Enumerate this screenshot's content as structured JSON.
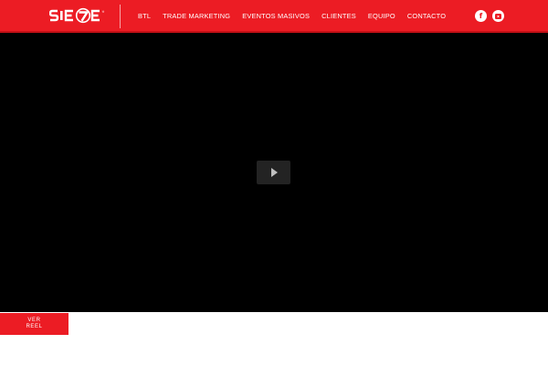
{
  "header": {
    "brand": "SIE7E",
    "nav": [
      {
        "label": "BTL"
      },
      {
        "label": "TRADE MARKETING"
      },
      {
        "label": "EVENTOS MASIVOS"
      },
      {
        "label": "CLIENTES"
      },
      {
        "label": "EQUIPO"
      },
      {
        "label": "CONTACTO"
      }
    ],
    "social": [
      {
        "icon": "facebook-icon",
        "glyph": "f"
      },
      {
        "icon": "youtube-icon"
      }
    ]
  },
  "video": {
    "play_icon": "play-icon"
  },
  "reel": {
    "line1": "VER",
    "line2": "REEL"
  },
  "colors": {
    "brand_red": "#ec1c24",
    "video_bg": "#000000",
    "play_button": "#232323"
  }
}
